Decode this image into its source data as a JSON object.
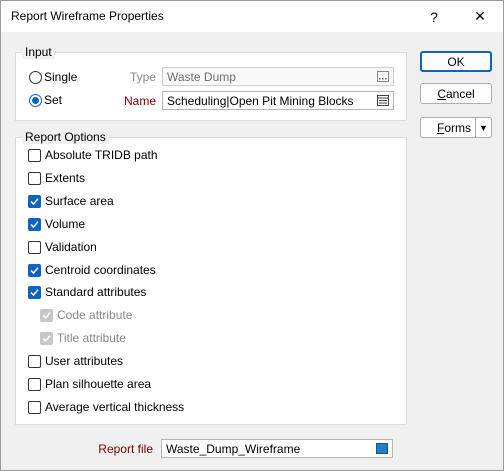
{
  "window": {
    "title": "Report Wireframe Properties",
    "help_glyph": "?",
    "close_glyph": "✕"
  },
  "input_group": {
    "legend": "Input",
    "single_label": "Single",
    "set_label": "Set",
    "selected": "set",
    "type_label": "Type",
    "type_value": "Waste Dump",
    "name_label": "Name",
    "name_value": "Scheduling|Open Pit Mining Blocks"
  },
  "report_options": {
    "legend": "Report Options",
    "items": [
      {
        "label": "Absolute TRIDB path",
        "checked": false,
        "disabled": false
      },
      {
        "label": "Extents",
        "checked": false,
        "disabled": false
      },
      {
        "label": "Surface area",
        "checked": true,
        "disabled": false
      },
      {
        "label": "Volume",
        "checked": true,
        "disabled": false
      },
      {
        "label": "Validation",
        "checked": false,
        "disabled": false
      },
      {
        "label": "Centroid coordinates",
        "checked": true,
        "disabled": false
      },
      {
        "label": "Standard attributes",
        "checked": true,
        "disabled": false
      },
      {
        "label": "Code attribute",
        "checked": true,
        "disabled": true
      },
      {
        "label": "Title attribute",
        "checked": true,
        "disabled": true
      },
      {
        "label": "User attributes",
        "checked": false,
        "disabled": false
      },
      {
        "label": "Plan silhouette area",
        "checked": false,
        "disabled": false
      },
      {
        "label": "Average vertical thickness",
        "checked": false,
        "disabled": false
      }
    ]
  },
  "report_file": {
    "label": "Report file",
    "value": "Waste_Dump_Wireframe"
  },
  "buttons": {
    "ok": "OK",
    "cancel": "Cancel",
    "forms": "Forms",
    "forms_arrow": "▼"
  },
  "colors": {
    "accent": "#0f62bd",
    "field_label": "#7a0000"
  }
}
